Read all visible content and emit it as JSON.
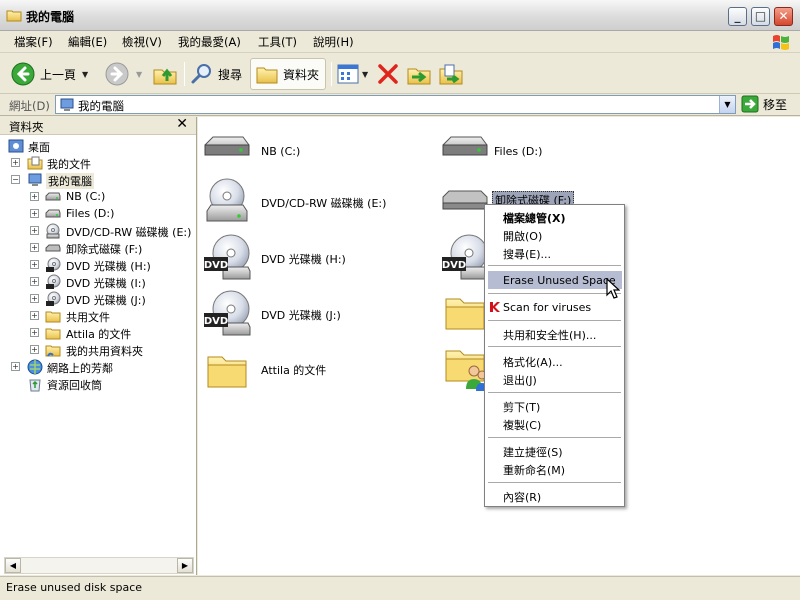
{
  "window": {
    "title": "我的電腦",
    "minimize": "_",
    "maximize": "□",
    "close": "✕"
  },
  "menu": {
    "items": [
      "檔案(F)",
      "編輯(E)",
      "檢視(V)",
      "我的最愛(A)",
      "工具(T)",
      "說明(H)"
    ]
  },
  "toolbar": {
    "back": "上一頁",
    "search": "搜尋",
    "folders": "資料夾"
  },
  "address": {
    "label": "網址(D)",
    "value": "我的電腦",
    "go": "移至"
  },
  "folder_pane": {
    "title": "資料夾",
    "close": "✕",
    "tree": [
      {
        "label": "桌面",
        "icon": "desktop-icon"
      },
      {
        "label": "我的文件",
        "icon": "my-documents-icon",
        "expander": "+"
      },
      {
        "label": "我的電腦",
        "icon": "my-computer-icon",
        "expander": "−",
        "selected": true
      },
      {
        "label": "NB (C:)",
        "icon": "hard-drive-icon",
        "expander": "+"
      },
      {
        "label": "Files (D:)",
        "icon": "hard-drive-icon",
        "expander": "+"
      },
      {
        "label": "DVD/CD-RW 磁碟機 (E:)",
        "icon": "cd-drive-icon",
        "expander": "+"
      },
      {
        "label": "卸除式磁碟 (F:)",
        "icon": "removable-disk-icon",
        "expander": "+"
      },
      {
        "label": "DVD 光碟機 (H:)",
        "icon": "dvd-drive-icon",
        "expander": "+"
      },
      {
        "label": "DVD 光碟機 (I:)",
        "icon": "dvd-drive-icon",
        "expander": "+"
      },
      {
        "label": "DVD 光碟機 (J:)",
        "icon": "dvd-drive-icon",
        "expander": "+"
      },
      {
        "label": "共用文件",
        "icon": "folder-icon",
        "expander": "+"
      },
      {
        "label": "Attila 的文件",
        "icon": "folder-icon",
        "expander": "+"
      },
      {
        "label": "我的共用資料夾",
        "icon": "shared-folder-icon",
        "expander": "+"
      },
      {
        "label": "網路上的芳鄰",
        "icon": "network-icon",
        "expander": "+"
      },
      {
        "label": "資源回收筒",
        "icon": "recycle-bin-icon"
      }
    ]
  },
  "content": {
    "items": [
      {
        "label": "NB (C:)",
        "icon": "hard-drive-icon"
      },
      {
        "label": "Files (D:)",
        "icon": "hard-drive-icon"
      },
      {
        "label": "DVD/CD-RW 磁碟機 (E:)",
        "icon": "cd-drive-icon"
      },
      {
        "label": "卸除式磁碟 (F:)",
        "icon": "removable-disk-icon",
        "selected": true
      },
      {
        "label": "DVD 光碟機 (H:)",
        "icon": "dvd-drive-icon"
      },
      {
        "label": "",
        "icon": "dvd-drive-icon"
      },
      {
        "label": "DVD 光碟機 (J:)",
        "icon": "dvd-drive-icon"
      },
      {
        "label": "",
        "icon": "folder-icon"
      },
      {
        "label": "Attila 的文件",
        "icon": "folder-icon"
      },
      {
        "label": "",
        "icon": "shared-users-folder-icon"
      }
    ]
  },
  "context_menu": {
    "explore": "檔案總管(X)",
    "open": "開啟(O)",
    "search": "搜尋(E)...",
    "erase": "Erase Unused Space",
    "scan": "Scan for viruses",
    "sharing": "共用和安全性(H)...",
    "format": "格式化(A)...",
    "eject": "退出(J)",
    "cut": "剪下(T)",
    "copy": "複製(C)",
    "shortcut": "建立捷徑(S)",
    "rename": "重新命名(M)",
    "properties": "內容(R)"
  },
  "status": {
    "text": "Erase unused disk space"
  },
  "colors": {
    "selection": "#9da4b8",
    "menu_highlight": "#b6bdd2",
    "chrome": "#ece9d8",
    "delete_red": "#e0241b",
    "go_green": "#3aa93a"
  }
}
